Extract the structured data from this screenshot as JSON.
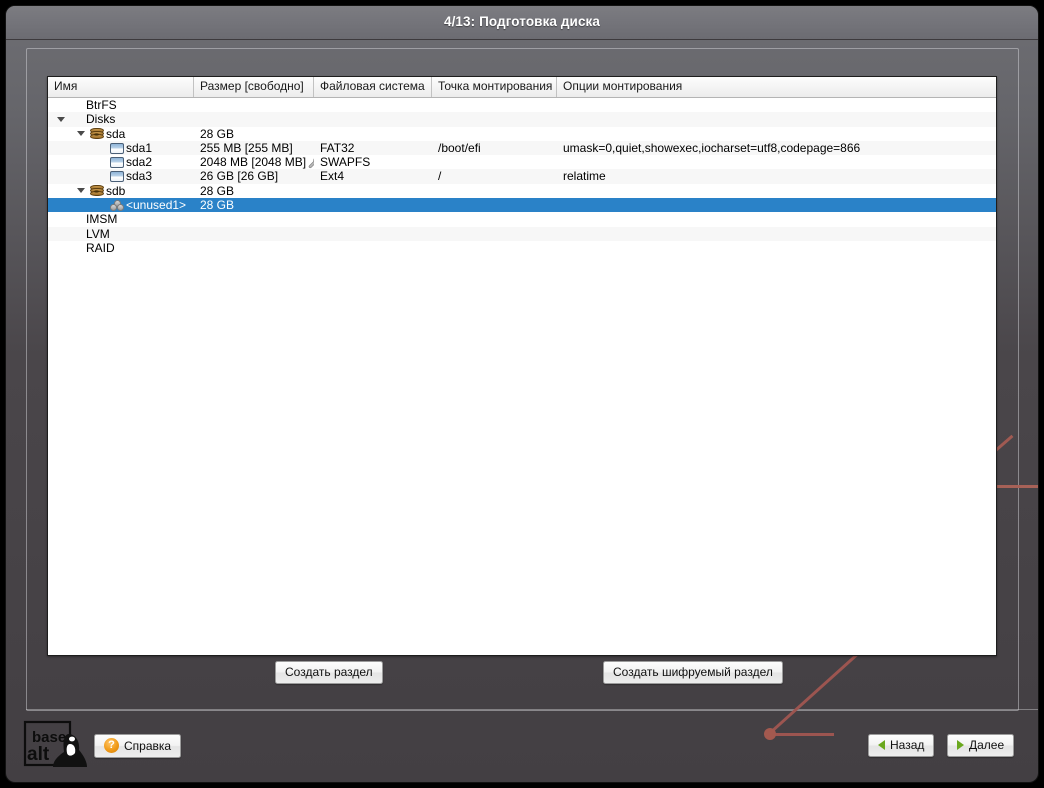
{
  "window": {
    "title": "4/13: Подготовка диска"
  },
  "tree": {
    "columns": [
      "Имя",
      "Размер [свободно]",
      "Файловая система",
      "Точка монтирования",
      "Опции монтирования"
    ],
    "rows": [
      {
        "name": "BtrFS",
        "size": "",
        "fs": "",
        "mount": "",
        "opts": "",
        "depth": 0,
        "twisty": "none",
        "icon": "none",
        "selected": false,
        "alt": false
      },
      {
        "name": "Disks",
        "size": "",
        "fs": "",
        "mount": "",
        "opts": "",
        "depth": 0,
        "twisty": "expanded",
        "icon": "none",
        "selected": false,
        "alt": true
      },
      {
        "name": "sda",
        "size": "28 GB",
        "fs": "",
        "mount": "",
        "opts": "",
        "depth": 1,
        "twisty": "expanded",
        "icon": "disk",
        "selected": false,
        "alt": false
      },
      {
        "name": "sda1",
        "size": "255 MB [255 MB]",
        "fs": "FAT32",
        "mount": "/boot/efi",
        "opts": "umask=0,quiet,showexec,iocharset=utf8,codepage=866",
        "depth": 2,
        "twisty": "none",
        "icon": "part",
        "selected": false,
        "alt": true
      },
      {
        "name": "sda2",
        "size": "2048 MB [2048 MB]",
        "fs": "SWAPFS",
        "mount": "",
        "opts": "",
        "depth": 2,
        "twisty": "none",
        "icon": "part",
        "selected": false,
        "alt": false,
        "wrench": true
      },
      {
        "name": "sda3",
        "size": "26 GB [26 GB]",
        "fs": "Ext4",
        "mount": "/",
        "opts": "relatime",
        "depth": 2,
        "twisty": "none",
        "icon": "part",
        "selected": false,
        "alt": true
      },
      {
        "name": "sdb",
        "size": "28 GB",
        "fs": "",
        "mount": "",
        "opts": "",
        "depth": 1,
        "twisty": "expanded",
        "icon": "disk",
        "selected": false,
        "alt": false
      },
      {
        "name": "<unused1>",
        "size": "28 GB",
        "fs": "",
        "mount": "",
        "opts": "",
        "depth": 2,
        "twisty": "none",
        "icon": "unused",
        "selected": true,
        "alt": false
      },
      {
        "name": "IMSM",
        "size": "",
        "fs": "",
        "mount": "",
        "opts": "",
        "depth": 0,
        "twisty": "none",
        "icon": "none",
        "selected": false,
        "alt": false
      },
      {
        "name": "LVM",
        "size": "",
        "fs": "",
        "mount": "",
        "opts": "",
        "depth": 0,
        "twisty": "none",
        "icon": "none",
        "selected": false,
        "alt": true
      },
      {
        "name": "RAID",
        "size": "",
        "fs": "",
        "mount": "",
        "opts": "",
        "depth": 0,
        "twisty": "none",
        "icon": "none",
        "selected": false,
        "alt": false
      }
    ]
  },
  "actions": {
    "create_partition": "Создать раздел",
    "create_encrypted_partition": "Создать шифруемый раздел"
  },
  "footer": {
    "logo_line1": "base",
    "logo_line2": "alt",
    "help": "Справка",
    "help_icon_glyph": "?",
    "back": "Назад",
    "next": "Далее"
  },
  "colors": {
    "selection": "#2a82c8",
    "accent_green": "#6aa81e",
    "help_orange": "#f09a17",
    "deco_red": "#a05a52"
  }
}
